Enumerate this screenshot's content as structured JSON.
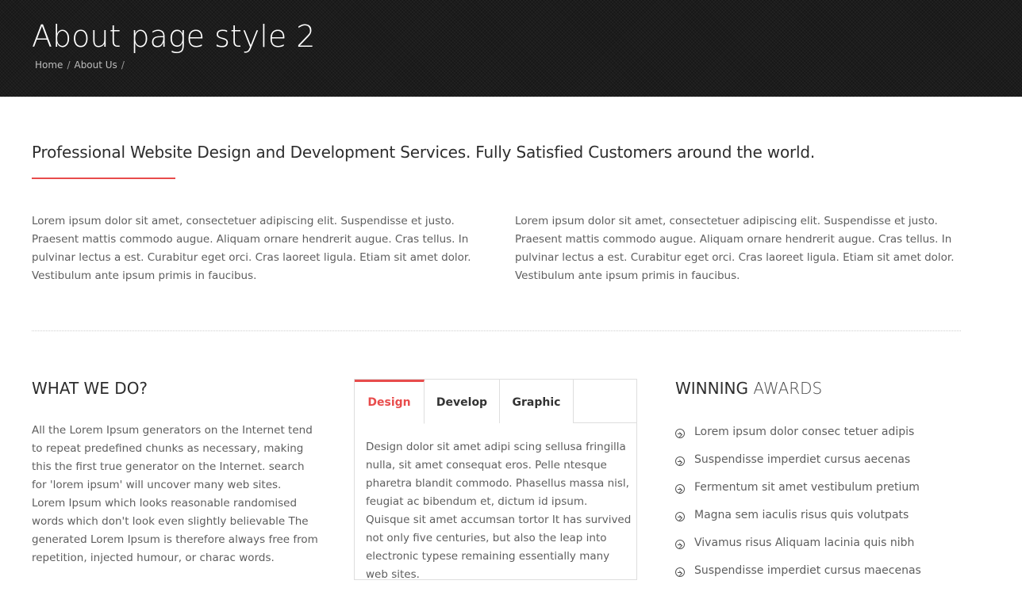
{
  "header": {
    "title": "About page style 2",
    "breadcrumb": [
      {
        "label": "Home"
      },
      {
        "label": "About Us"
      }
    ],
    "separator": "/"
  },
  "intro": {
    "heading": "Professional Website Design and Development Services. Fully Satisfied Customers around the world.",
    "col_left": "Lorem ipsum dolor sit amet, consectetuer adipiscing elit. Suspendisse et justo. Praesent mattis commodo augue. Aliquam ornare hendrerit augue. Cras tellus. In pulvinar lectus a est. Curabitur eget orci. Cras laoreet ligula. Etiam sit amet dolor. Vestibulum ante ipsum primis in faucibus.",
    "col_right": "Lorem ipsum dolor sit amet, consectetuer adipiscing elit. Suspendisse et justo. Praesent mattis commodo augue. Aliquam ornare hendrerit augue. Cras tellus. In pulvinar lectus a est. Curabitur eget orci. Cras laoreet ligula. Etiam sit amet dolor. Vestibulum ante ipsum primis in faucibus."
  },
  "what_we_do": {
    "heading": "WHAT WE DO?",
    "paragraph_1": "All the Lorem Ipsum generators on the Internet tend to repeat predefined chunks as necessary, making this the first true generator on the Internet. search for 'lorem ipsum' will uncover many web sites.",
    "paragraph_2": "Lorem Ipsum which looks reasonable randomised words which don't look even slightly believable The generated Lorem Ipsum is therefore always free from repetition, injected humour, or charac words."
  },
  "tabs": {
    "items": [
      {
        "label": "Design",
        "active": true
      },
      {
        "label": "Develop",
        "active": false
      },
      {
        "label": "Graphic",
        "active": false
      }
    ],
    "content": "Design dolor sit amet adipi scing sellusa fringilla nulla, sit amet consequat eros. Pelle ntesque pharetra blandit commodo. Phasellus massa nisl, feugiat ac bibendum et, dictum id ipsum. Quisque sit amet accumsan tortor It has survived not only five centuries, but also the leap into electronic typese remaining essentially many web sites."
  },
  "awards": {
    "heading_bold": "WINNING",
    "heading_thin": "AWARDS",
    "icon": "circle-arrow-right-icon",
    "items": [
      "Lorem ipsum dolor consec tetuer adipis",
      "Suspendisse imperdiet cursus aecenas",
      "Fermentum sit amet vestibulum pretium",
      "Magna sem iaculis risus quis volutpats",
      "Vivamus risus Aliquam lacinia quis nibh",
      "Suspendisse imperdiet cursus maecenas"
    ]
  },
  "colors": {
    "accent": "#e84c4c",
    "header_bg": "#1c1c1c",
    "text": "#5e5e5e",
    "heading": "#2d2d2d"
  }
}
